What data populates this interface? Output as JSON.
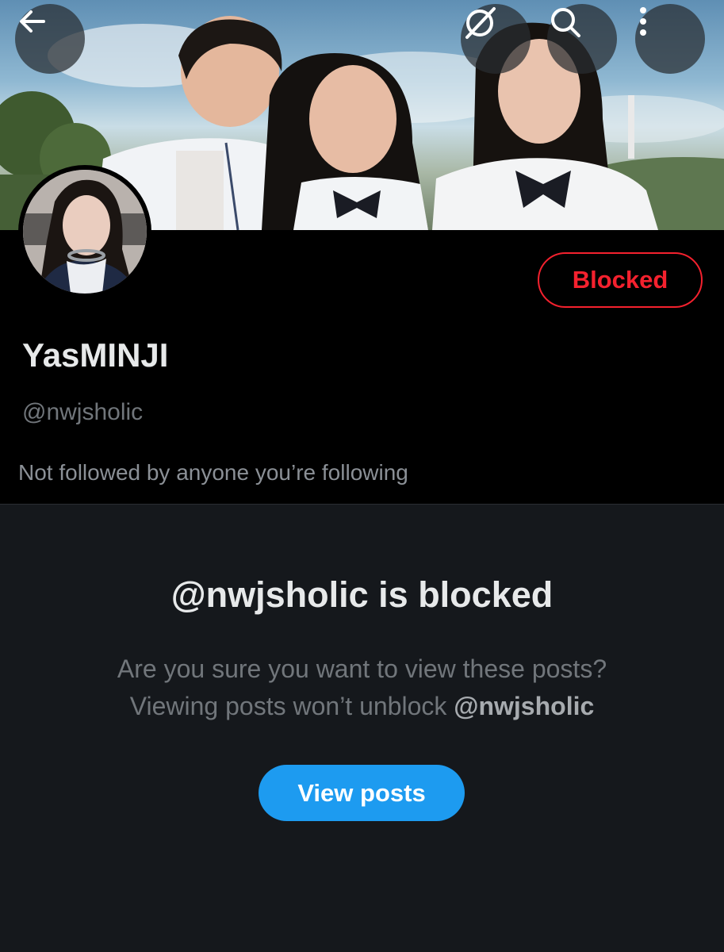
{
  "header": {
    "back_icon": "arrow-left-icon",
    "grok_icon": "grok-slash-icon",
    "search_icon": "search-icon",
    "more_icon": "more-vertical-icon"
  },
  "profile": {
    "display_name": "YasMINJI",
    "handle": "@nwjsholic",
    "followed_note": "Not followed by anyone you’re following",
    "blocked_label": "Blocked"
  },
  "blocked_notice": {
    "title": "@nwjsholic is blocked",
    "line1": "Are you sure you want to view these posts?",
    "line2_prefix": "Viewing posts won’t unblock ",
    "line2_handle": "@nwjsholic",
    "button_label": "View posts"
  },
  "colors": {
    "accent_blue": "#1d9bf0",
    "blocked_red": "#f4212e",
    "background": "#15181c"
  }
}
